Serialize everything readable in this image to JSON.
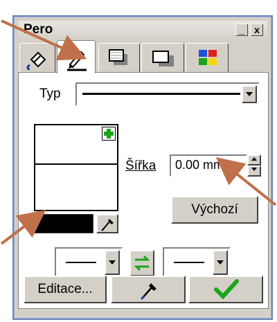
{
  "window": {
    "title": "Pero"
  },
  "titlebar_buttons": {
    "minimize": "_",
    "close": "x"
  },
  "tabs": [
    {
      "name": "fill",
      "icon": "paint-bucket-icon"
    },
    {
      "name": "pen",
      "icon": "pen-icon",
      "active": true
    },
    {
      "name": "shadow",
      "icon": "shadow-icon"
    },
    {
      "name": "frame",
      "icon": "frame-icon"
    },
    {
      "name": "colors",
      "icon": "color-grid-icon"
    }
  ],
  "typ": {
    "label": "Typ"
  },
  "sirka": {
    "label": "Šířka",
    "value": "0.00 mm"
  },
  "buttons": {
    "default": "Výchozí",
    "edit": "Editace..."
  },
  "colors": {
    "pen_color": "#000000",
    "accent_green": "#1aa51a",
    "callout_arrow": "#c0704a",
    "window_frame": "#6e86b8"
  },
  "icons": {
    "add": "plus-icon",
    "eyedropper": "eyedropper-icon",
    "swap": "swap-arrows-icon",
    "ok": "checkmark-icon"
  }
}
